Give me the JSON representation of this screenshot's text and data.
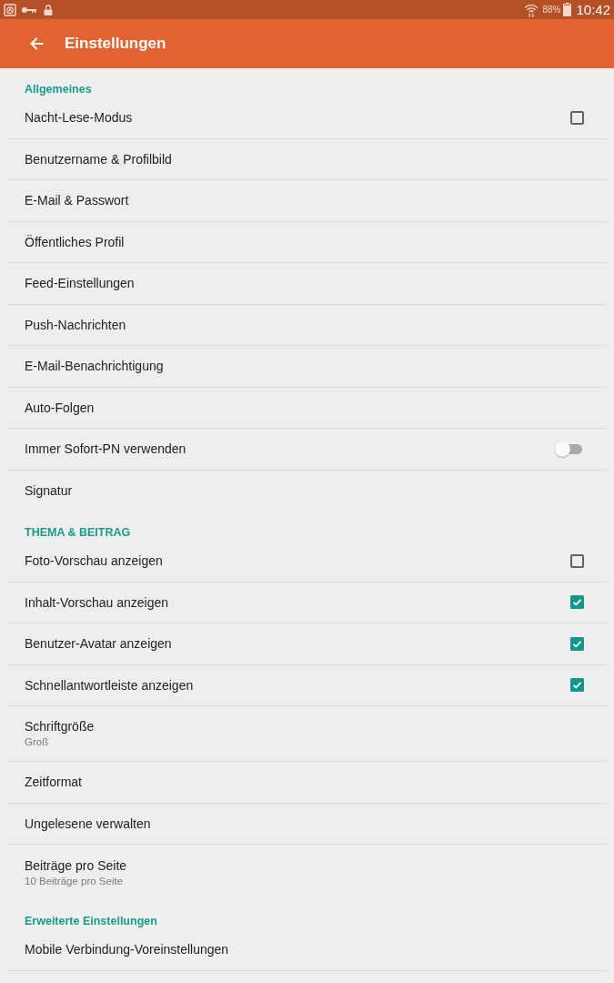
{
  "status_bar": {
    "battery": "88%",
    "time": "10:42"
  },
  "app_bar": {
    "title": "Einstellungen"
  },
  "sections": [
    {
      "title": "Allgemeines",
      "items": [
        {
          "kind": "checkbox",
          "label": "Nacht-Lese-Modus",
          "checked": false
        },
        {
          "kind": "link",
          "label": "Benutzername & Profilbild"
        },
        {
          "kind": "link",
          "label": "E-Mail & Passwort"
        },
        {
          "kind": "link",
          "label": "Öffentliches Profil"
        },
        {
          "kind": "link",
          "label": "Feed-Einstellungen"
        },
        {
          "kind": "link",
          "label": "Push-Nachrichten"
        },
        {
          "kind": "link",
          "label": "E-Mail-Benachrichtigung"
        },
        {
          "kind": "link",
          "label": "Auto-Folgen"
        },
        {
          "kind": "switch",
          "label": "Immer Sofort-PN verwenden",
          "on": false
        },
        {
          "kind": "link",
          "label": "Signatur"
        }
      ]
    },
    {
      "title": "THEMA & BEITRAG",
      "items": [
        {
          "kind": "checkbox",
          "label": "Foto-Vorschau anzeigen",
          "checked": false
        },
        {
          "kind": "checkbox",
          "label": "Inhalt-Vorschau anzeigen",
          "checked": true
        },
        {
          "kind": "checkbox",
          "label": "Benutzer-Avatar anzeigen",
          "checked": true
        },
        {
          "kind": "checkbox",
          "label": "Schnellantwortleiste anzeigen",
          "checked": true
        },
        {
          "kind": "link",
          "label": "Schriftgröße",
          "summary": "Groß"
        },
        {
          "kind": "link",
          "label": "Zeitformat"
        },
        {
          "kind": "link",
          "label": "Ungelesene verwalten"
        },
        {
          "kind": "link",
          "label": "Beiträge pro Seite",
          "summary": "10 Beiträge pro Seite"
        }
      ]
    },
    {
      "title": "Erweiterte Einstellungen",
      "items": [
        {
          "kind": "link",
          "label": "Mobile Verbindung-Voreinstellungen"
        }
      ]
    }
  ]
}
